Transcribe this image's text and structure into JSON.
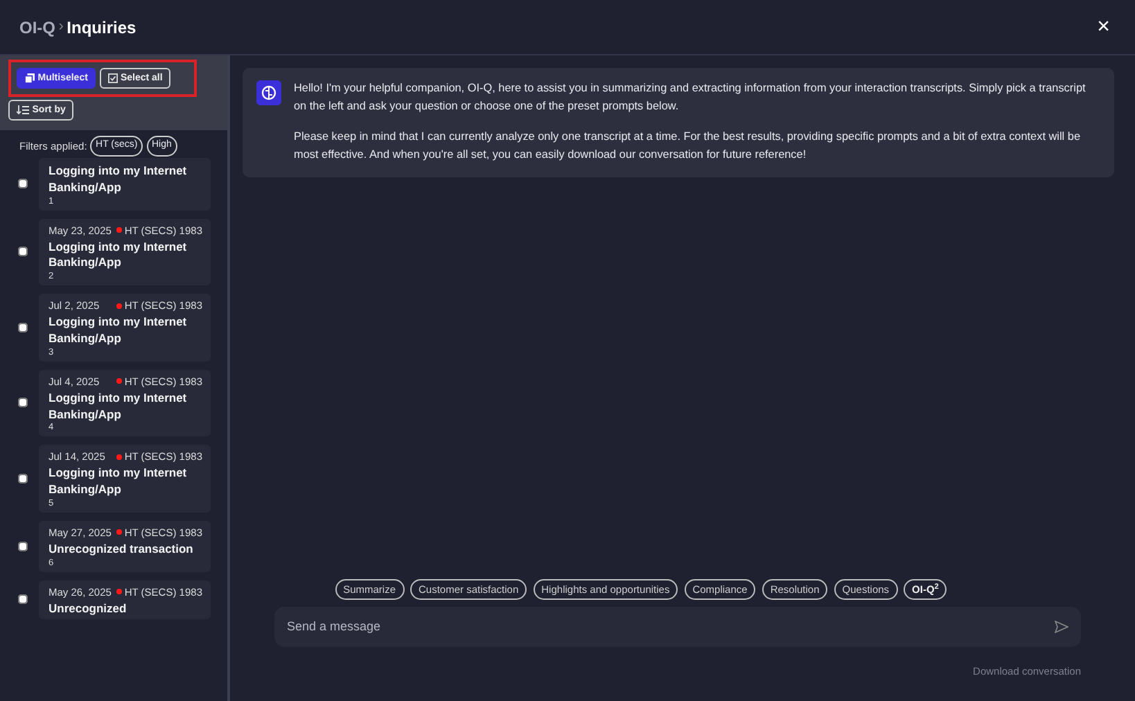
{
  "header": {
    "app": "OI-Q",
    "separator": "›",
    "title": "Inquiries",
    "close": "×"
  },
  "toolbar": {
    "multiselect": {
      "label": "Multiselect",
      "active": true
    },
    "select_all": "Select all",
    "sort": "Sort by",
    "highlighted": true
  },
  "filters": {
    "label": "Filters applied:",
    "chips": [
      "HT (secs)",
      "High"
    ]
  },
  "transcripts": [
    {
      "title": "Logging into my Internet Banking/App",
      "number": "1",
      "checked": false
    },
    {
      "date": "May 23, 2025",
      "tag": "HT (SECS) 1983",
      "title": "Logging into my Internet Banking/App",
      "number": "2",
      "checked": false,
      "color": "#ff1a1a"
    },
    {
      "date": "Jul 2, 2025",
      "tag": "HT (SECS) 1983",
      "title": "Logging into my Internet Banking/App",
      "number": "3",
      "checked": false,
      "color": "#ff1a1a"
    },
    {
      "date": "Jul 4, 2025",
      "tag": "HT (SECS) 1983",
      "title": "Logging into my Internet Banking/App",
      "number": "4",
      "checked": false,
      "color": "#ff1a1a"
    },
    {
      "date": "Jul 14, 2025",
      "tag": "HT (SECS) 1983",
      "title": "Logging into my Internet Banking/App",
      "number": "5",
      "checked": false,
      "color": "#ff1a1a"
    },
    {
      "date": "May 27, 2025",
      "tag": "HT (SECS) 1983",
      "title": "Unrecognized transaction",
      "number": "6",
      "checked": false,
      "color": "#ff1a1a"
    },
    {
      "date": "May 26, 2025",
      "tag": "HT (SECS) 1983",
      "title": "Unrecognized",
      "checked": false,
      "color": "#ff1a1a"
    }
  ],
  "chat": {
    "messages": [
      "Hello! I'm your helpful companion, OI-Q, here to assist you in summarizing and extracting information from your interaction transcripts. Simply pick a transcript on the left and ask your question or choose one of the preset prompts below.",
      "Please keep in mind that I can currently analyze only one transcript at a time. For the best results, providing specific prompts and a bit of extra context will be most effective. And when you're all set, you can easily download our conversation for future reference!"
    ],
    "prompts": [
      "Summarize",
      "Customer satisfaction",
      "Highlights and opportunities",
      "Compliance",
      "Resolution",
      "Questions",
      "OI-Q$^{2}$"
    ],
    "input": {
      "placeholder": "Send a message"
    },
    "download": "Download conversation"
  }
}
